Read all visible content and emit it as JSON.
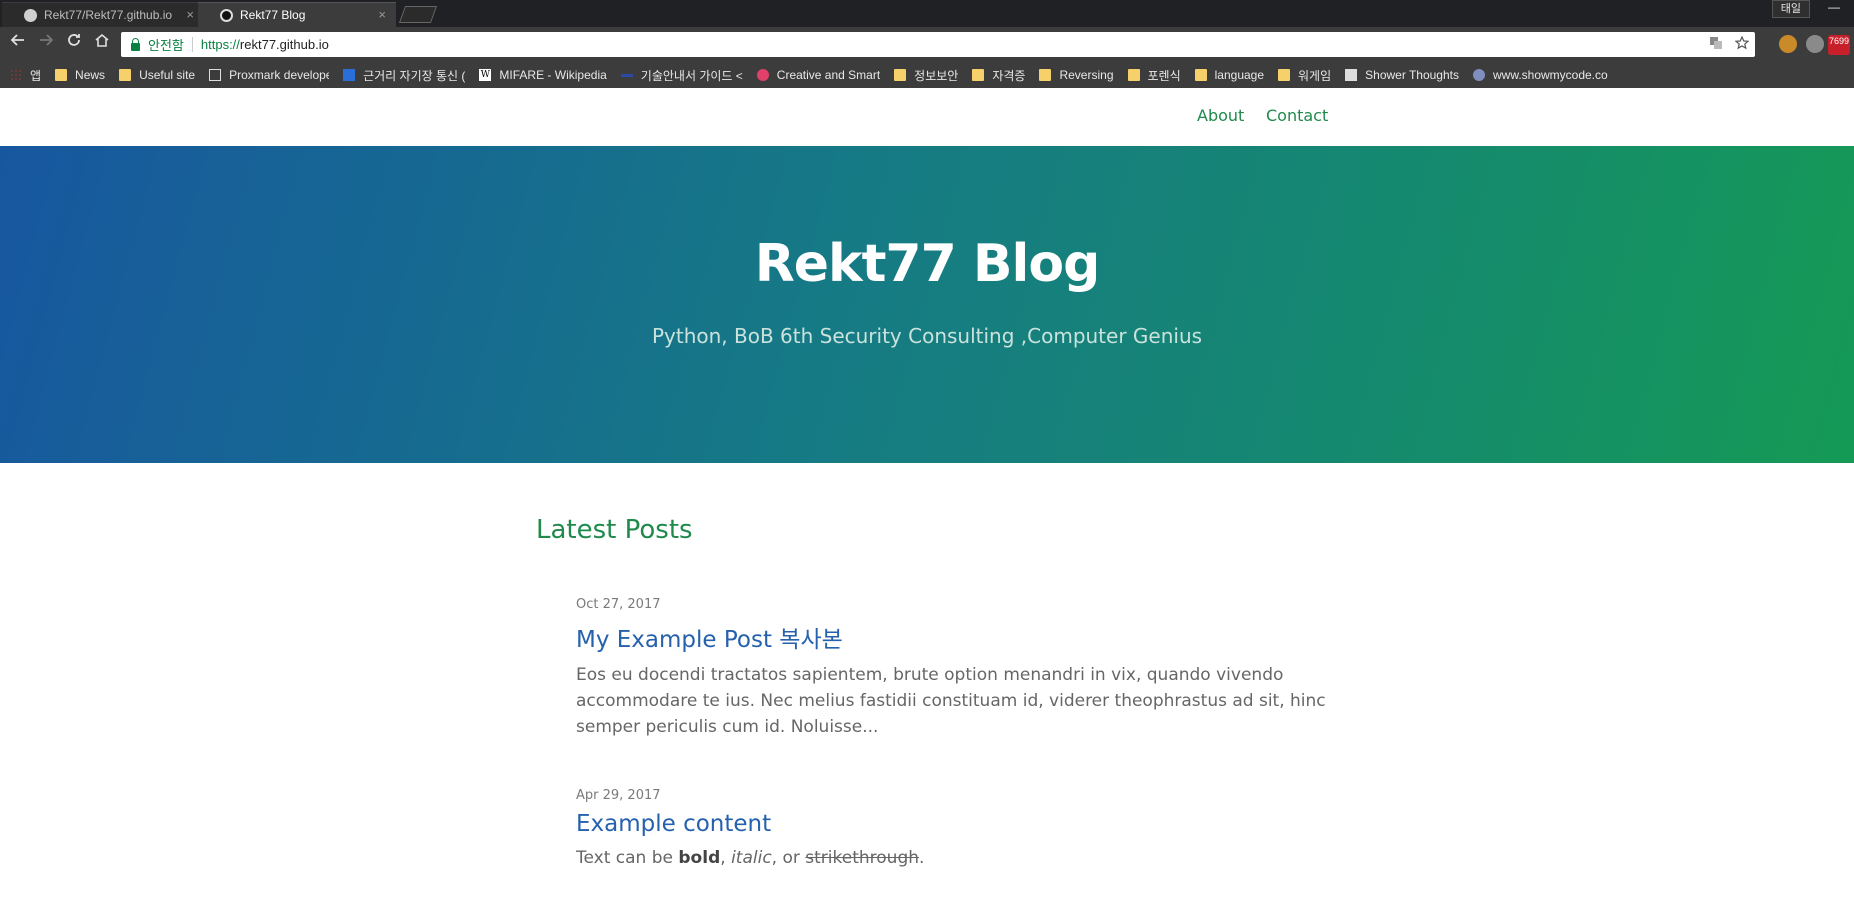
{
  "browser": {
    "tabs": [
      {
        "title": "Rekt77/Rekt77.github.io",
        "active": false
      },
      {
        "title": "Rekt77 Blog",
        "active": true
      }
    ],
    "tab_close_glyph": "×",
    "user_label": "태일",
    "minimize_glyph": "—",
    "omnibox": {
      "secure_label": "안전함",
      "url_scheme": "https://",
      "url_host": "rekt77.github.io"
    },
    "mail_badge": "7699",
    "bookmarks": [
      {
        "label": "앱",
        "icon": "apps-icon"
      },
      {
        "label": "News",
        "icon": "folder-icon"
      },
      {
        "label": "Useful site",
        "icon": "folder-icon"
      },
      {
        "label": "Proxmark developers",
        "icon": "page-icon"
      },
      {
        "label": "근거리 자기장 통신 (",
        "icon": "e-icon"
      },
      {
        "label": "MIFARE - Wikipedia",
        "icon": "wikipedia-icon"
      },
      {
        "label": "기술안내서 가이드 <",
        "icon": "line-icon"
      },
      {
        "label": "Creative and Smart",
        "icon": "red-circle-icon"
      },
      {
        "label": "정보보안",
        "icon": "folder-icon"
      },
      {
        "label": "자격증",
        "icon": "folder-icon"
      },
      {
        "label": "Reversing",
        "icon": "folder-icon"
      },
      {
        "label": "포렌식",
        "icon": "folder-icon"
      },
      {
        "label": "language",
        "icon": "folder-icon"
      },
      {
        "label": "워게임",
        "icon": "folder-icon"
      },
      {
        "label": "Shower Thoughts",
        "icon": "gear-icon"
      },
      {
        "label": "www.showmycode.co",
        "icon": "round-icon"
      }
    ]
  },
  "site": {
    "nav": {
      "about": "About",
      "contact": "Contact"
    },
    "hero": {
      "title": "Rekt77 Blog",
      "subtitle": "Python, BoB 6th Security Consulting ,Computer Genius"
    },
    "latest_posts_title": "Latest Posts",
    "posts": [
      {
        "date": "Oct 27, 2017",
        "title": "My Example Post 복사본",
        "excerpt": "Eos eu docendi tractatos sapientem, brute option menandri in vix, quando vivendo accommodare te ius. Nec melius fastidii constituam id, viderer theophrastus ad sit, hinc semper periculis cum id. Noluisse..."
      },
      {
        "date": "Apr 29, 2017",
        "title": "Example content",
        "excerpt_parts": {
          "p1": "Text can be ",
          "bold": "bold",
          "p2": ", ",
          "italic": "italic",
          "p3": ", or ",
          "strike": "strikethrough",
          "p4": "."
        }
      }
    ]
  },
  "colors": {
    "accent_green": "#1f8a4c",
    "link_blue": "#2561ad",
    "hero_start": "#17579f",
    "hero_end": "#159a55"
  }
}
